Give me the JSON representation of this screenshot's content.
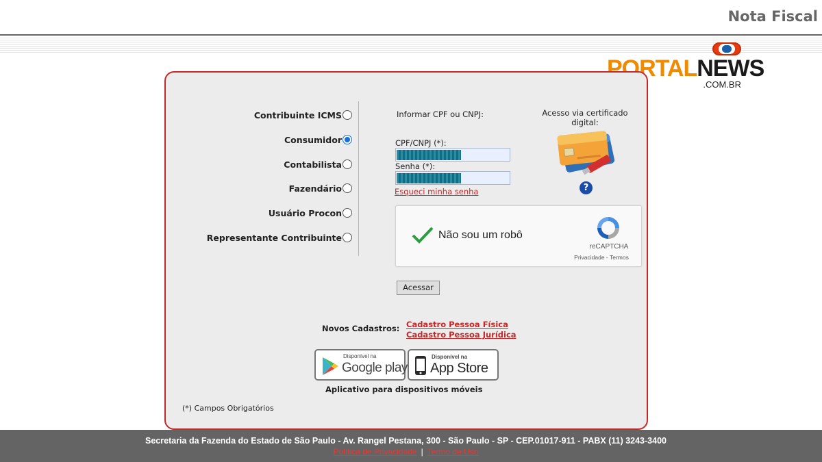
{
  "header": {
    "title": "Nota Fiscal"
  },
  "logo": {
    "part1": "PORTAL",
    "part2": "NEWS",
    "domain": ".COM.BR"
  },
  "roles": [
    {
      "label": "Contribuinte ICMS",
      "checked": false
    },
    {
      "label": "Consumidor",
      "checked": true
    },
    {
      "label": "Contabilista",
      "checked": false
    },
    {
      "label": "Fazendário",
      "checked": false
    },
    {
      "label": "Usuário Procon",
      "checked": false
    },
    {
      "label": "Representante Contribuinte",
      "checked": false
    }
  ],
  "login": {
    "inform_label": "Informar CPF ou CNPJ:",
    "cpf_label": "CPF/CNPJ (*):",
    "senha_label": "Senha (*):",
    "forgot_link": "Esqueci minha senha",
    "cert_label": "Acesso via certificado digital:",
    "help_icon": "?",
    "submit_label": "Acessar"
  },
  "captcha": {
    "text": "Não sou um robô",
    "brand": "reCAPTCHA",
    "links": "Privacidade - Termos",
    "checked": true
  },
  "cadastros": {
    "label": "Novos Cadastros:",
    "link_pf": "Cadastro Pessoa Física",
    "link_pj": "Cadastro Pessoa Jurídica"
  },
  "stores": {
    "google": {
      "small": "Disponível na",
      "big": "Google play"
    },
    "apple": {
      "small": "Disponível na",
      "big": "App Store"
    },
    "caption": "Aplicativo para dispositivos móveis"
  },
  "required_note": "(*) Campos Obrigatórios",
  "footer": {
    "address": "Secretaria da Fazenda do Estado de São Paulo - Av. Rangel Pestana, 300 - São Paulo - SP - CEP.01017-911 - PABX (11) 3243-3400",
    "privacy_link": "Política de Privacidade",
    "separator": "|",
    "terms_link": "Termo de Uso"
  },
  "colors": {
    "accent_red": "#c62828",
    "panel_bg": "#ececec",
    "footer_bg": "#646464",
    "radio_blue": "#1a6fd6"
  }
}
